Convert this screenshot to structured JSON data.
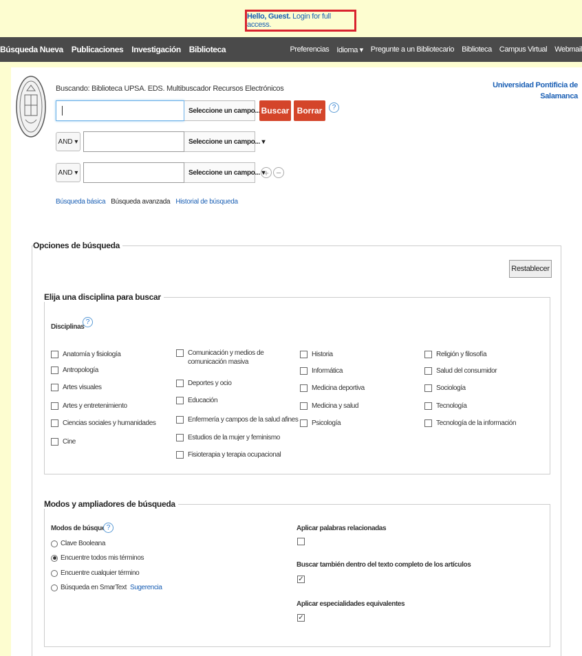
{
  "guest": {
    "hello": "Hello, Guest.",
    "login": "Login for full access."
  },
  "nav_left": [
    "Búsqueda Nueva",
    "Publicaciones",
    "Investigación",
    "Biblioteca"
  ],
  "nav_right": [
    "Preferencias",
    "Idioma ▾",
    "Pregunte a un Bibliotecario",
    "Biblioteca",
    "Campus Virtual",
    "Webmail"
  ],
  "search": {
    "searching": "Buscando: Biblioteca UPSA. EDS. Multibuscador Recursos Electrónicos",
    "field_select": "Seleccione un campo... ▾",
    "and": "AND ▾",
    "search_btn": "Buscar",
    "clear_btn": "Borrar",
    "help": "?"
  },
  "university": {
    "line1": "Universidad Pontificia de",
    "line2": "Salamanca"
  },
  "links": {
    "basic": "Búsqueda básica",
    "advanced": "Búsqueda avanzada",
    "history": "Historial de búsqueda"
  },
  "options": {
    "title": "Opciones de búsqueda",
    "reset": "Restablecer",
    "discipline_title": "Elija una disciplina para buscar",
    "disciplines_label": "Disciplinas",
    "disciplines": [
      [
        "Anatomía y fisiología",
        "Antropología",
        "Artes visuales",
        "Artes y entretenimiento",
        "Ciencias sociales y humanidades",
        "Cine"
      ],
      [
        "Comunicación y medios de comunicación masiva",
        "Deportes y ocio",
        "Educación",
        "Enfermería y campos de la salud afines",
        "Estudios de la mujer y feminismo",
        "Fisioterapia y terapia ocupacional"
      ],
      [
        "Historia",
        "Informática",
        "Medicina deportiva",
        "Medicina y salud",
        "Psicología"
      ],
      [
        "Religión y filosofía",
        "Salud del consumidor",
        "Sociología",
        "Tecnología",
        "Tecnología de la información"
      ]
    ],
    "modes_title": "Modos y ampliadores de búsqueda",
    "modes_label": "Modos de búsqueda",
    "modes": [
      "Clave Booleana",
      "Encuentre todos mis términos",
      "Encuentre cualquier término",
      "Búsqueda en SmarText"
    ],
    "suggestion": "Sugerencia",
    "expander1": "Aplicar palabras relacionadas",
    "expander2": "Buscar también dentro del texto completo de los artículos",
    "expander3": "Aplicar especialidades equivalentes",
    "check_mark": "✓"
  },
  "colors": {
    "nav": "#4a4a4a",
    "guest_bg": "#fdfdd0",
    "accent": "#d4452a",
    "link": "#1a5fb4"
  }
}
